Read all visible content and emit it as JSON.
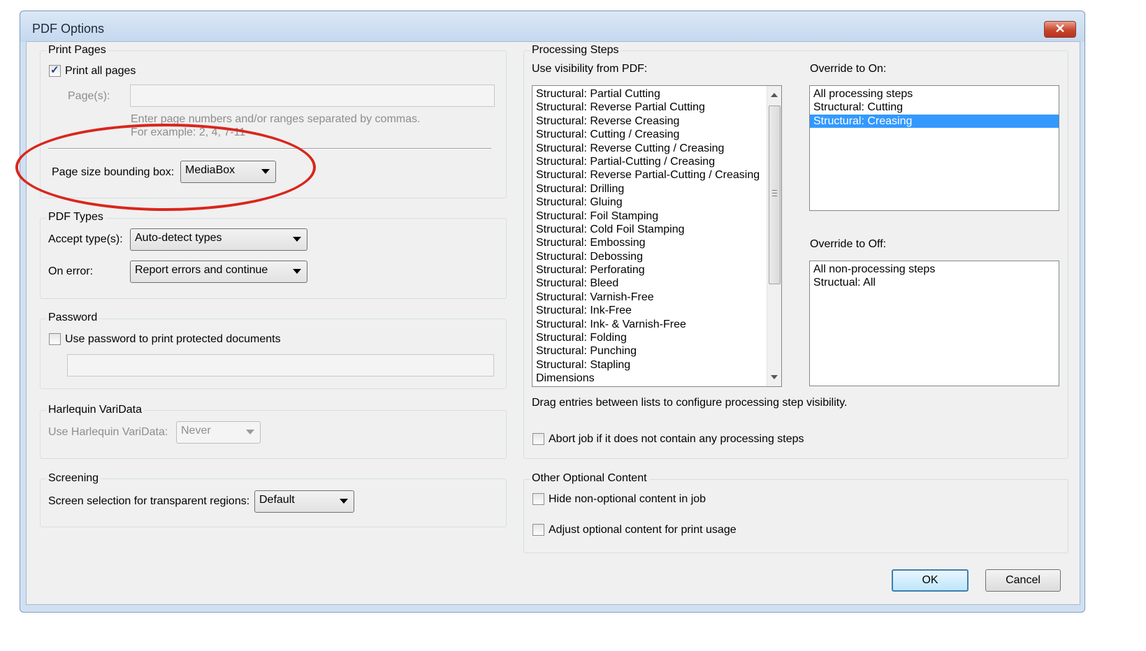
{
  "window": {
    "title": "PDF Options",
    "close_label": "✕"
  },
  "print_pages": {
    "group_label": "Print Pages",
    "print_all_label": "Print all pages",
    "print_all_checked": true,
    "pages_label": "Page(s):",
    "pages_value": "",
    "hint_line1": "Enter page numbers and/or ranges separated by commas.",
    "hint_line2": "For example: 2, 4, 7-11",
    "bbox_label": "Page size bounding box:",
    "bbox_value": "MediaBox"
  },
  "pdf_types": {
    "group_label": "PDF Types",
    "accept_label": "Accept type(s):",
    "accept_value": "Auto-detect types",
    "on_error_label": "On error:",
    "on_error_value": "Report errors and continue"
  },
  "password": {
    "group_label": "Password",
    "use_password_label": "Use password to print protected documents",
    "use_password_checked": false,
    "password_value": ""
  },
  "varidata": {
    "group_label": "Harlequin VariData",
    "use_label": "Use Harlequin VariData:",
    "use_value": "Never"
  },
  "screening": {
    "group_label": "Screening",
    "selection_label": "Screen selection for transparent regions:",
    "selection_value": "Default"
  },
  "processing_steps": {
    "group_label": "Processing Steps",
    "use_visibility_label": "Use visibility from PDF:",
    "visibility_items": [
      "Structural: Partial Cutting",
      "Structural: Reverse Partial Cutting",
      "Structural: Reverse Creasing",
      "Structural: Cutting / Creasing",
      "Structural: Reverse Cutting / Creasing",
      "Structural: Partial-Cutting / Creasing",
      "Structural: Reverse Partial-Cutting / Creasing",
      "Structural: Drilling",
      "Structural: Gluing",
      "Structural: Foil Stamping",
      "Structural: Cold Foil Stamping",
      "Structural: Embossing",
      "Structural: Debossing",
      "Structural: Perforating",
      "Structural: Bleed",
      "Structural: Varnish-Free",
      "Structural: Ink-Free",
      "Structural: Ink- & Varnish-Free",
      "Structural: Folding",
      "Structural: Punching",
      "Structural: Stapling",
      "Dimensions"
    ],
    "override_on_label": "Override to On:",
    "override_on_items": [
      "All processing steps",
      "Structural: Cutting",
      "Structural: Creasing"
    ],
    "override_on_selected": "Structural: Creasing",
    "override_off_label": "Override to Off:",
    "override_off_items": [
      "All non-processing steps",
      "Structual: All"
    ],
    "drag_hint": "Drag entries between lists to configure processing step visibility.",
    "abort_label": "Abort job if it does not contain any processing steps",
    "abort_checked": false
  },
  "other_optional": {
    "group_label": "Other Optional Content",
    "hide_label": "Hide non-optional content in job",
    "hide_checked": false,
    "adjust_label": "Adjust optional content for print usage",
    "adjust_checked": false
  },
  "buttons": {
    "ok": "OK",
    "cancel": "Cancel"
  },
  "annotation": {
    "color": "#d9261c"
  }
}
